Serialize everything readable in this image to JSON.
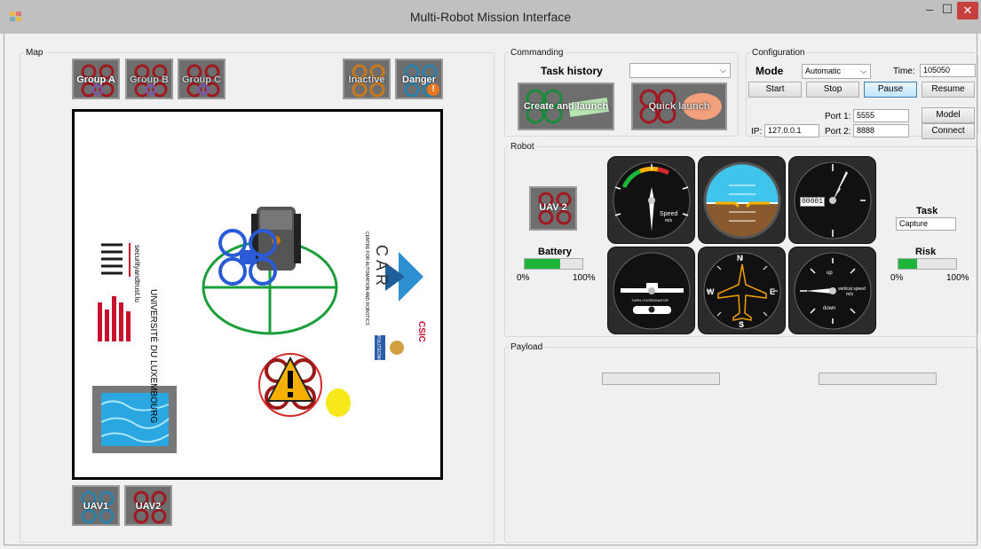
{
  "window": {
    "title": "Multi-Robot Mission Interface"
  },
  "map": {
    "legend": "Map",
    "groups": [
      "Group A",
      "Group B",
      "Group C"
    ],
    "status": [
      "Inactive",
      "Danger"
    ],
    "danger_badge": "!",
    "uavs": [
      "UAV1",
      "UAV2"
    ],
    "logos": {
      "snt": "SNT",
      "snt_sub": "securityandtrust.lu",
      "uni": "UNIVERSITÉ DU LUXEMBOURG",
      "car": "CAR",
      "car_sub": "CENTRE FOR AUTOMATION AND ROBOTICS",
      "upm": "POLITÉCNICA",
      "csic": "CSIC"
    }
  },
  "commanding": {
    "legend": "Commanding",
    "task_history_label": "Task history",
    "task_history_value": "",
    "create_label": "Create and launch",
    "quick_label": "Quick launch"
  },
  "configuration": {
    "legend": "Configuration",
    "mode_label": "Mode",
    "mode_value": "Automatic",
    "time_label": "Time:",
    "time_value": "105050",
    "start": "Start",
    "stop": "Stop",
    "pause": "Pause",
    "resume": "Resume",
    "port1_label": "Port 1:",
    "port1_value": "5555",
    "port2_label": "Port 2:",
    "port2_value": "8888",
    "ip_label": "IP:",
    "ip_value": "127.0.0.1",
    "model": "Model",
    "connect": "Connect"
  },
  "robot": {
    "legend": "Robot",
    "uav_label": "UAV 2",
    "battery_label": "Battery",
    "battery_min": "0%",
    "battery_max": "100%",
    "battery_level": 0.62,
    "task_label": "Task",
    "task_value": "Capture",
    "risk_label": "Risk",
    "risk_min": "0%",
    "risk_max": "100%",
    "risk_level": 0.33,
    "gauges": {
      "speed_label": "Speed",
      "speed_unit": "m/s",
      "altimeter_readout": "00001",
      "turn_label": "TURN COORDINATOR",
      "heading_n": "N",
      "heading_e": "E",
      "heading_s": "S",
      "heading_w": "W",
      "vs_label": "vertical speed",
      "vs_unit": "m/s",
      "vs_up": "up",
      "vs_down": "down"
    }
  },
  "payload": {
    "legend": "Payload"
  },
  "colors": {
    "accent": "#1db53a",
    "close": "#c74040",
    "danger": "#e87722"
  }
}
